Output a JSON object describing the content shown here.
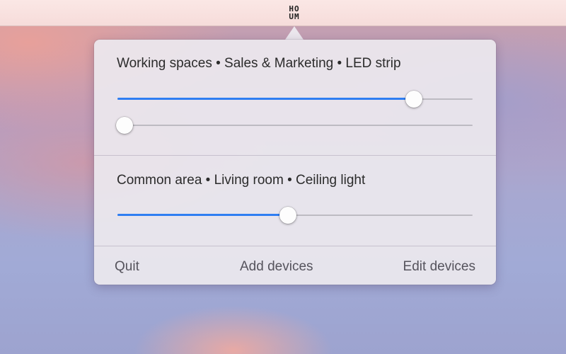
{
  "menubar": {
    "app_icon_top": "HO",
    "app_icon_bottom": "UM",
    "app_icon": "houm-logo-icon"
  },
  "devices": [
    {
      "label": "Working spaces • Sales & Marketing • LED strip",
      "sliders": [
        {
          "value": 0.835
        },
        {
          "value": 0.02
        }
      ]
    },
    {
      "label": "Common area • Living room • Ceiling light",
      "sliders": [
        {
          "value": 0.48
        }
      ]
    }
  ],
  "footer": {
    "quit_label": "Quit",
    "add_label": "Add devices",
    "edit_label": "Edit devices"
  },
  "colors": {
    "accent": "#2f7ef2",
    "track": "#bdbbc2"
  }
}
